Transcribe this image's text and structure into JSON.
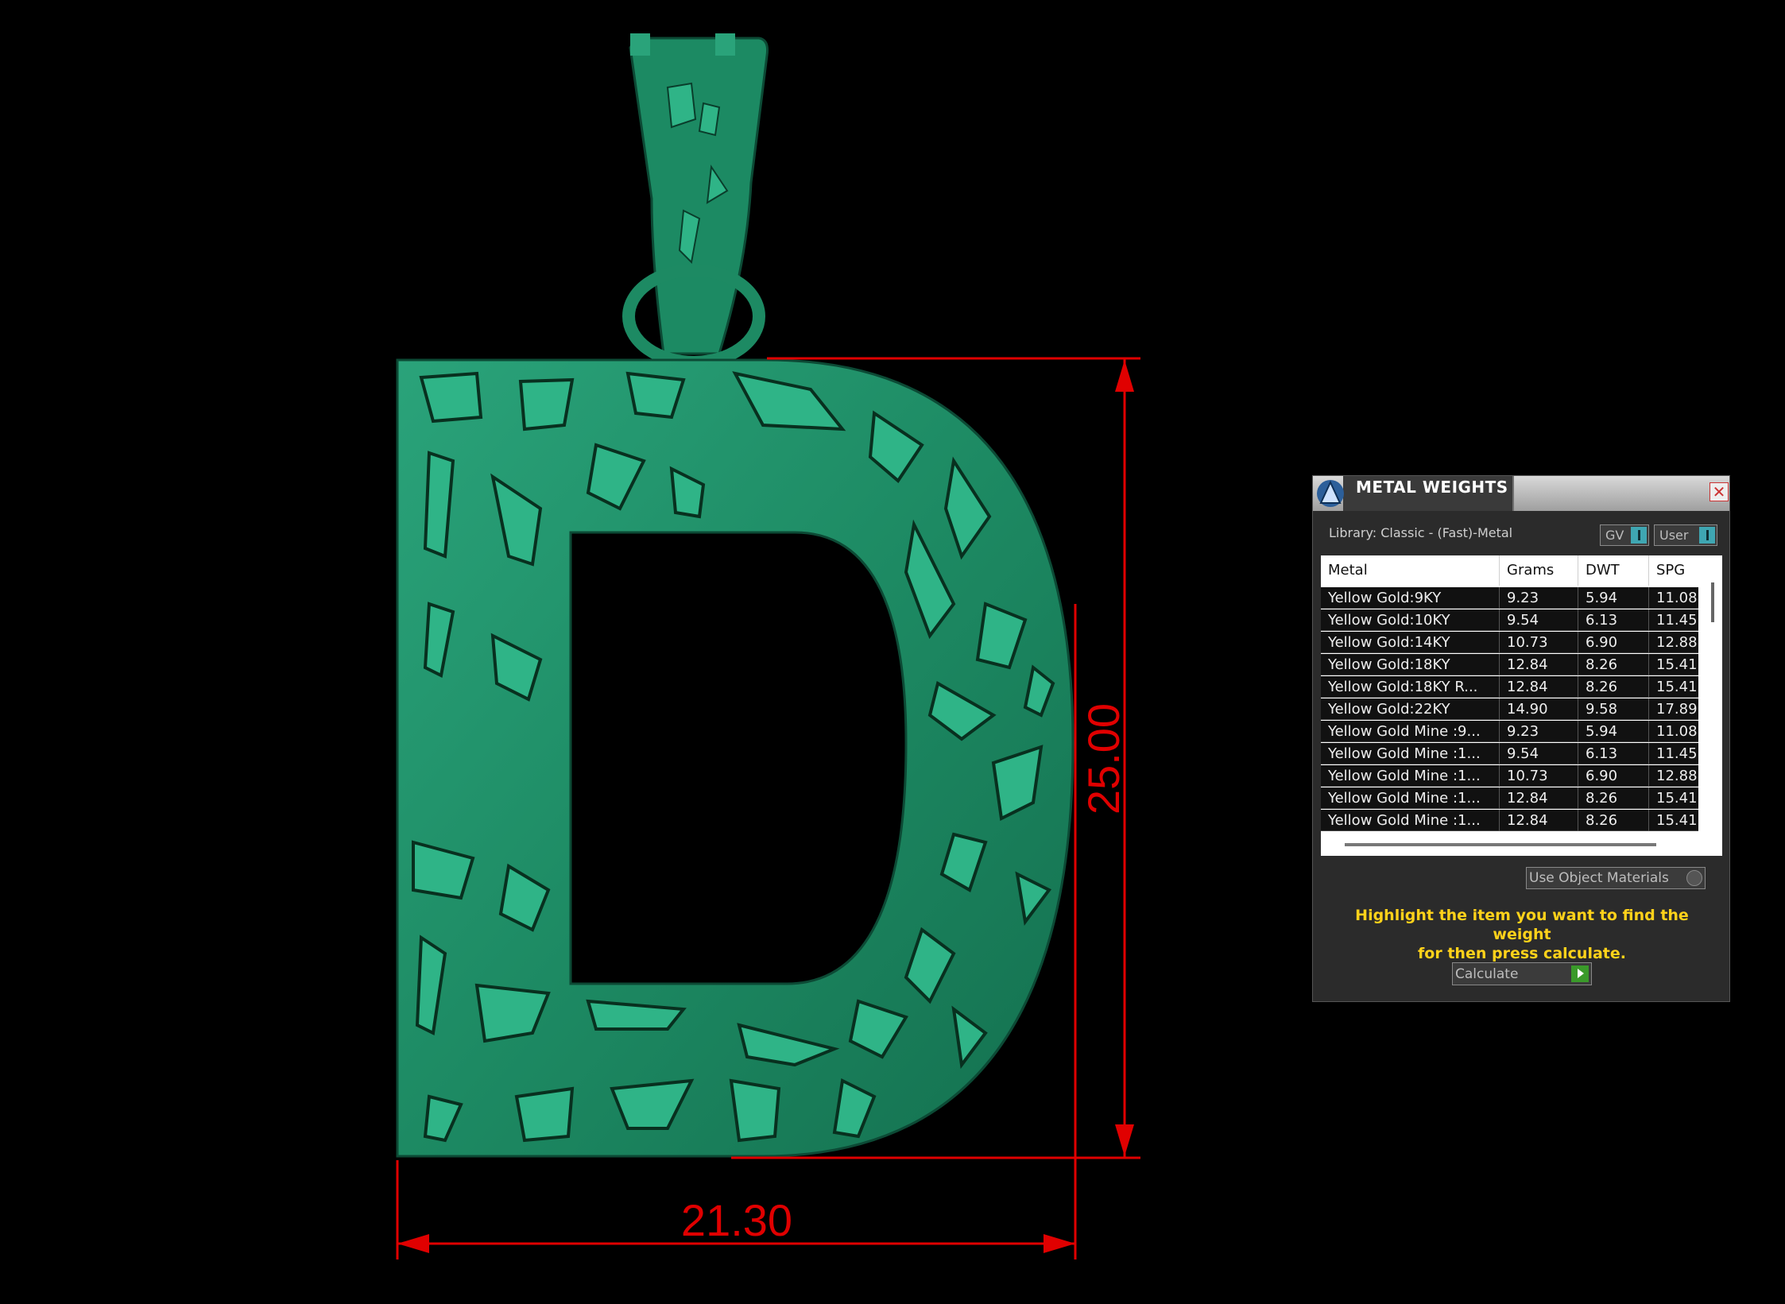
{
  "dimensions": {
    "width_label": "21.30",
    "height_label": "25.00"
  },
  "colors": {
    "background": "#000000",
    "model": "#1f8f68",
    "dimension": "#e00000",
    "hint": "#ffd21a"
  },
  "panel": {
    "title": "METAL WEIGHTS",
    "close_glyph": "✕",
    "library": "Library: Classic - (Fast)-Metal",
    "toggle_gv": "GV",
    "toggle_user": "User",
    "columns": [
      "Metal",
      "Grams",
      "DWT",
      "SPG"
    ],
    "rows": [
      [
        "Yellow Gold:9KY",
        "9.23",
        "5.94",
        "11.08"
      ],
      [
        "Yellow Gold:10KY",
        "9.54",
        "6.13",
        "11.45"
      ],
      [
        "Yellow Gold:14KY",
        "10.73",
        "6.90",
        "12.88"
      ],
      [
        "Yellow Gold:18KY",
        "12.84",
        "8.26",
        "15.41"
      ],
      [
        "Yellow Gold:18KY R...",
        "12.84",
        "8.26",
        "15.41"
      ],
      [
        "Yellow Gold:22KY",
        "14.90",
        "9.58",
        "17.89"
      ],
      [
        "Yellow Gold Mine :9...",
        "9.23",
        "5.94",
        "11.08"
      ],
      [
        "Yellow Gold Mine :1...",
        "9.54",
        "6.13",
        "11.45"
      ],
      [
        "Yellow Gold Mine :1...",
        "10.73",
        "6.90",
        "12.88"
      ],
      [
        "Yellow Gold Mine :1...",
        "12.84",
        "8.26",
        "15.41"
      ],
      [
        "Yellow Gold Mine :1...",
        "12.84",
        "8.26",
        "15.41"
      ]
    ],
    "use_object_materials": "Use Object Materials",
    "hint_line1": "Highlight the item you want to find the weight",
    "hint_line2": "for then press calculate.",
    "calculate": "Calculate"
  }
}
